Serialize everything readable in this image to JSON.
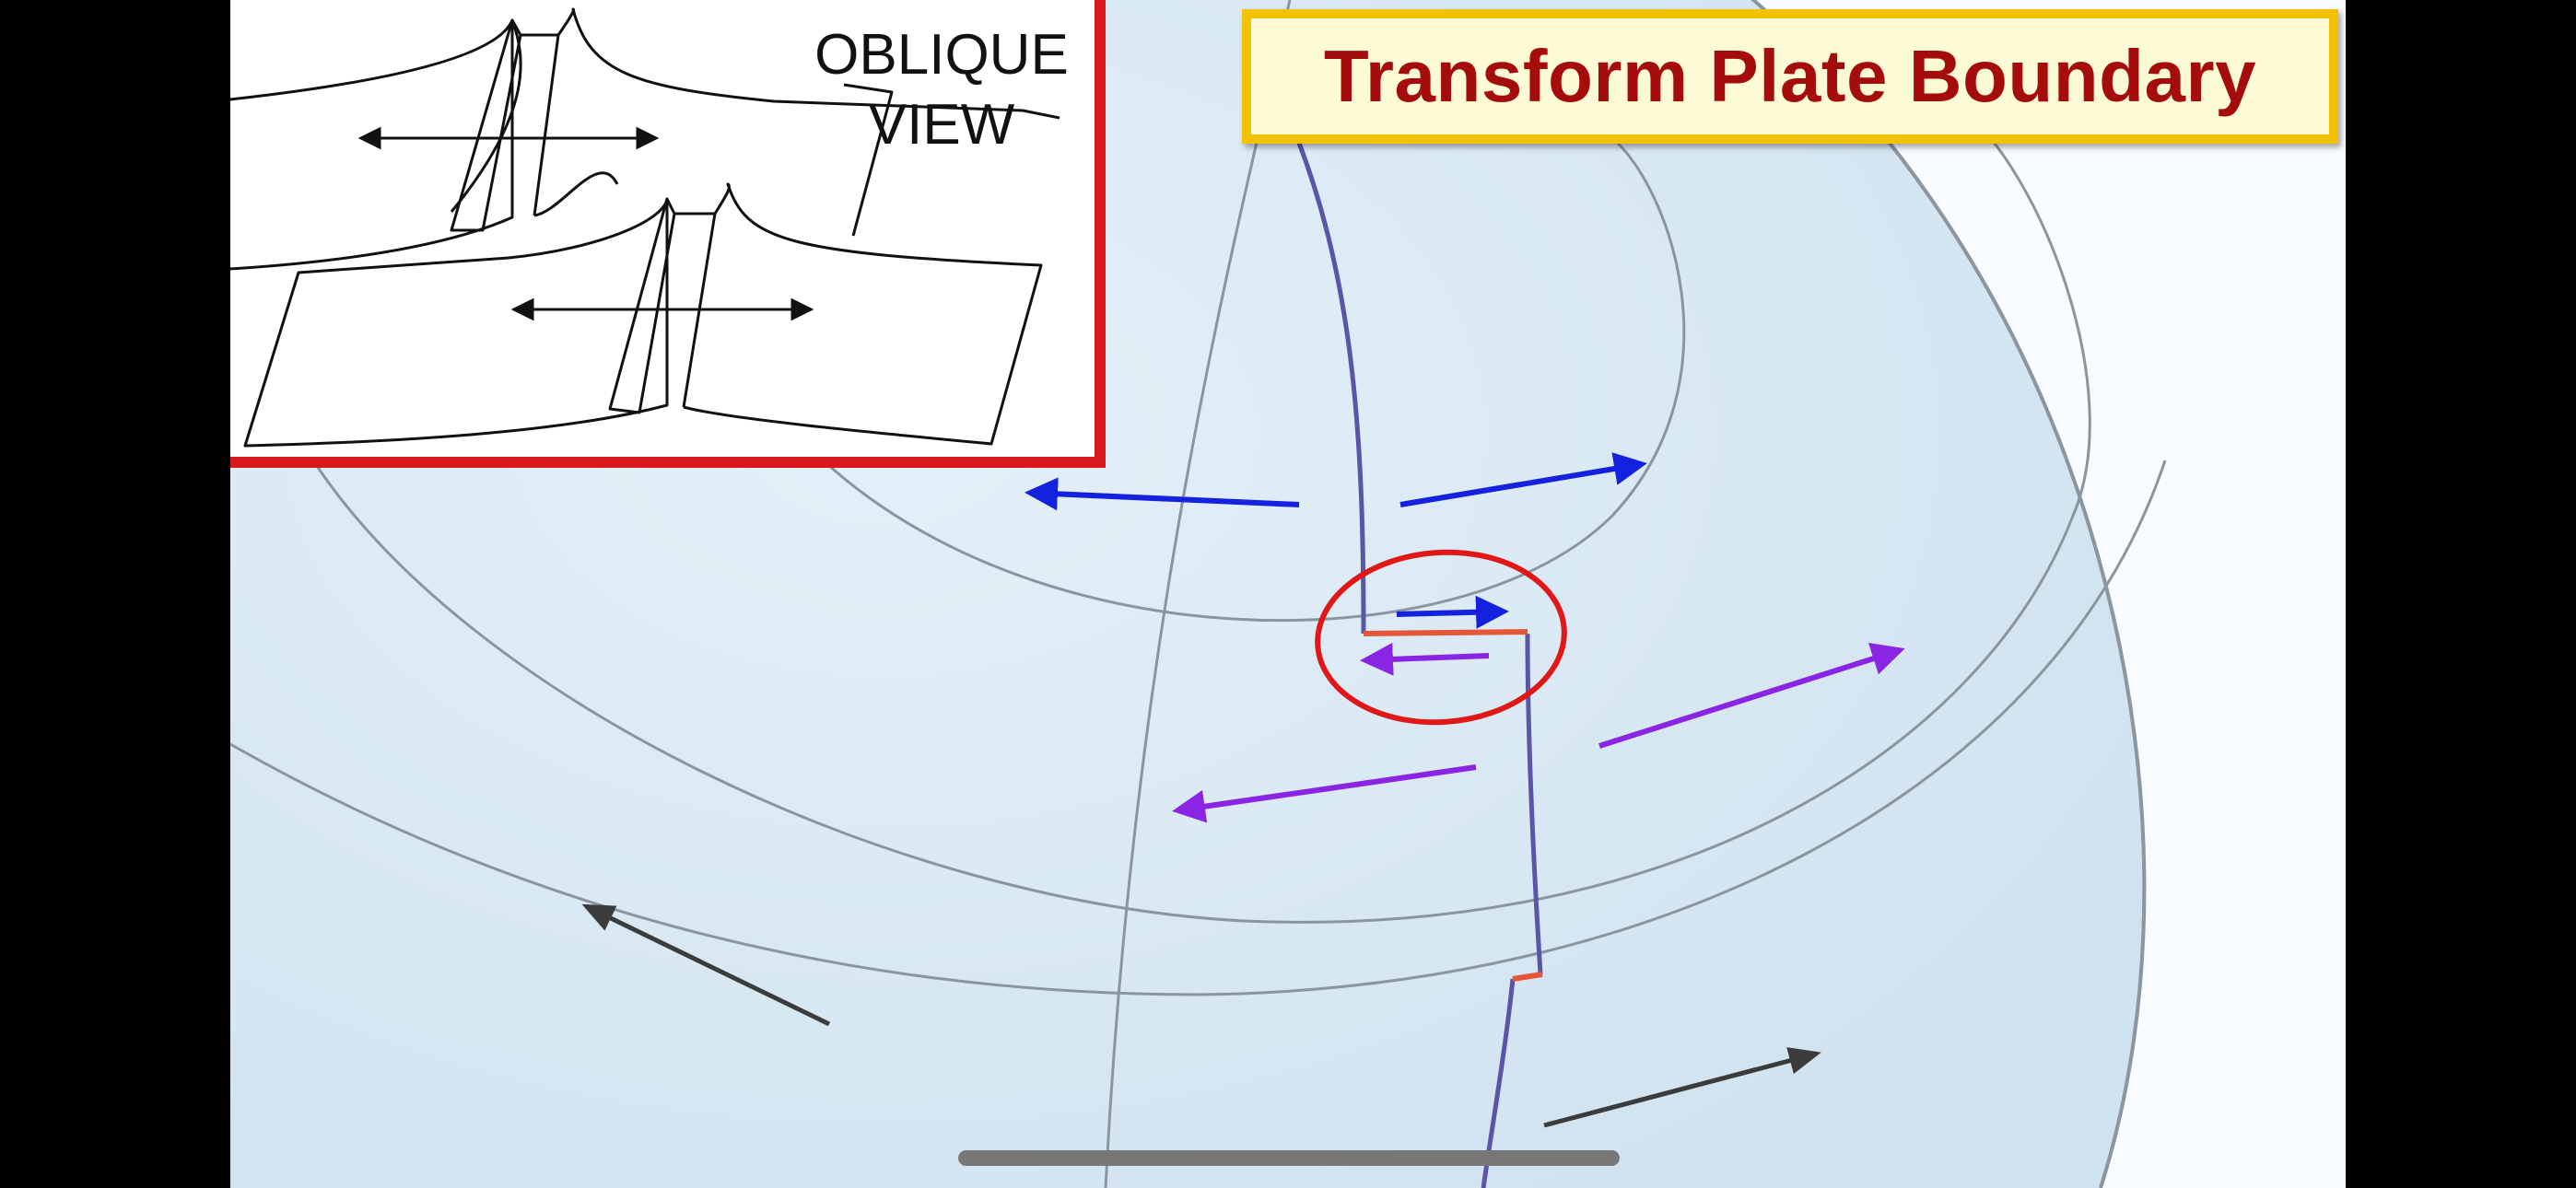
{
  "title": "Transform Plate Boundary",
  "inset": {
    "label_line1": "OBLIQUE",
    "label_line2": "VIEW"
  },
  "colors": {
    "background": "#000000",
    "globe": "#e9f3fa",
    "title_text": "#a50d0d",
    "title_border": "#f2c200",
    "title_fill": "#fdfbd6",
    "inset_border": "#d7191c",
    "ridge": "#5b55a8",
    "transform_fault": "#e4553a",
    "blue_arrow": "#1422e0",
    "purple_arrow": "#8a25e3",
    "rotation_arrow": "#3c3c3c",
    "highlight_circle": "#e01818"
  },
  "icons": {
    "highlight": "red-circle-highlight",
    "home_indicator": "home-indicator-bar"
  }
}
